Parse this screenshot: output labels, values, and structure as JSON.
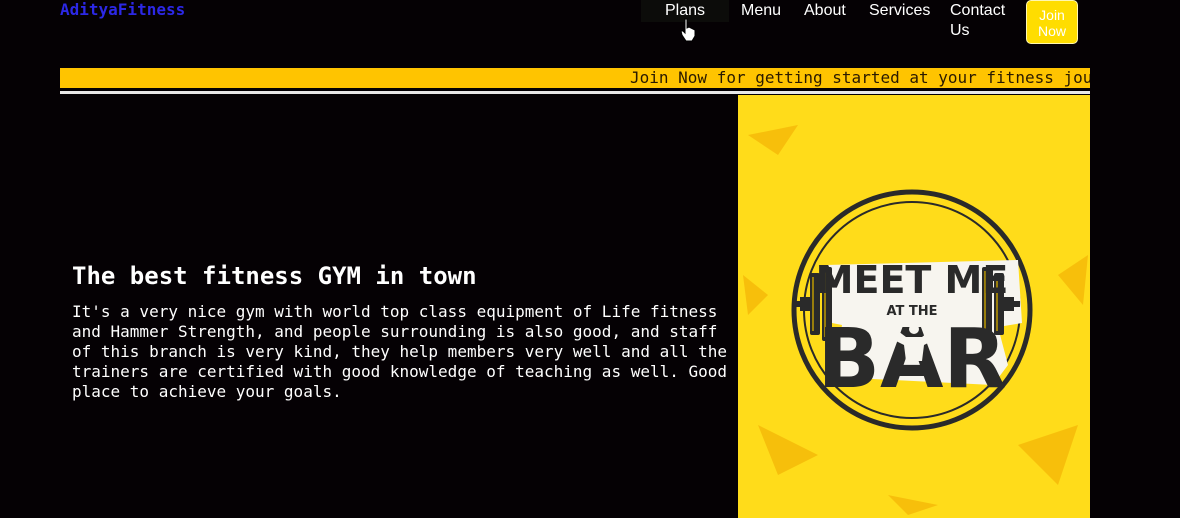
{
  "brand": {
    "name": "AdityaFitness"
  },
  "nav": {
    "items": [
      {
        "label": "Plans"
      },
      {
        "label": "Menu"
      },
      {
        "label": "About"
      },
      {
        "label": "Services"
      },
      {
        "label": "Contact Us"
      }
    ],
    "join_button": "Join Now"
  },
  "marquee": {
    "text": "Join Now for getting started at your fitness journey"
  },
  "hero": {
    "title": "The best fitness GYM in town",
    "description": "It's a very nice gym with world top class equipment of Life fitness and Hammer Strength, and people surrounding is also good, and staff of this branch is very kind, they help members very well and all the trainers are certified with good knowledge of teaching as well. Good place to achieve your goals.",
    "image": {
      "line1": "MEET ME",
      "line2": "AT THE",
      "line3": "BAR"
    }
  },
  "colors": {
    "background": "#050104",
    "brand": "#2c28e6",
    "accent": "#ffdd00",
    "marquee": "#ffc400"
  }
}
